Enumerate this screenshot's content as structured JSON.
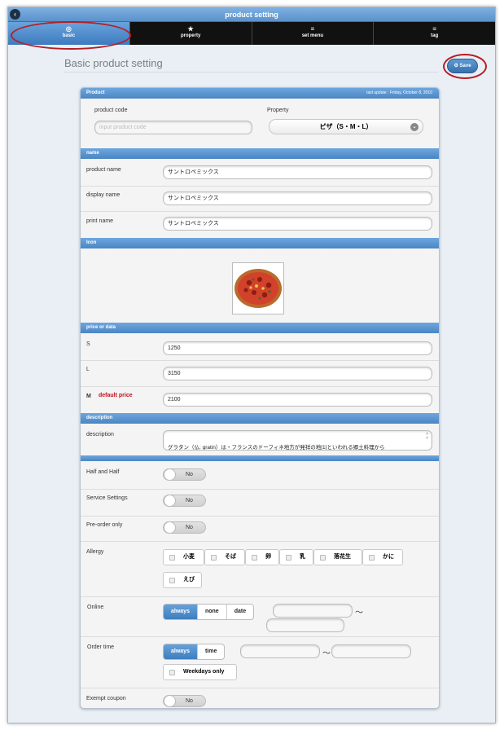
{
  "window": {
    "title": "product setting"
  },
  "tabs": [
    {
      "icon": "circle-icon",
      "glyph": "◎",
      "label": "basic"
    },
    {
      "icon": "star-icon",
      "glyph": "★",
      "label": "property"
    },
    {
      "icon": "menu-icon",
      "glyph": "≡",
      "label": "set menu"
    },
    {
      "icon": "menu-icon",
      "glyph": "≡",
      "label": "tag"
    }
  ],
  "page": {
    "title": "Basic product setting",
    "save_label": "Save"
  },
  "product": {
    "section": "Product",
    "last_update": "last update : Friday, October 8, 2010",
    "code_label": "product code",
    "code_placeholder": "input product code",
    "property_label": "Property",
    "property_value": "ピザ（S・M・L）"
  },
  "name": {
    "section": "name",
    "product_name_label": "product name",
    "product_name": "サントロペミックス",
    "display_name_label": "display name",
    "display_name": "サントロペミックス",
    "print_name_label": "print name",
    "print_name": "サントロペミックス"
  },
  "icon": {
    "section": "Icon"
  },
  "price": {
    "section": "price or data",
    "s_label": "S",
    "s_value": "1250",
    "l_label": "L",
    "l_value": "3150",
    "m_label": "M",
    "m_note": "default price",
    "m_value": "2100"
  },
  "description": {
    "section": "description",
    "label": "description",
    "text": "グラタン（仏: gratin）は・フランスのドーフィネ地方が発祥の地[1]といわれる郷土料理から"
  },
  "options": {
    "half_label": "Half and Half",
    "half_value": "No",
    "service_label": "Service Settings",
    "service_value": "No",
    "preorder_label": "Pre-order only",
    "preorder_value": "No",
    "allergy_label": "Allergy",
    "allergies": [
      "小麦",
      "そば",
      "卵",
      "乳",
      "落花生",
      "かに",
      "えび"
    ],
    "online_label": "Online",
    "online_options": [
      "always",
      "none",
      "date"
    ],
    "order_time_label": "Order time",
    "order_time_options": [
      "always",
      "time"
    ],
    "weekdays_label": "Weekdays only",
    "tilde": "〜",
    "coupon_label": "Exempt coupon",
    "coupon_value": "No"
  },
  "colors": {
    "accent": "#4a86c4",
    "alert": "#c0121b",
    "annotation": "#b81d24"
  }
}
